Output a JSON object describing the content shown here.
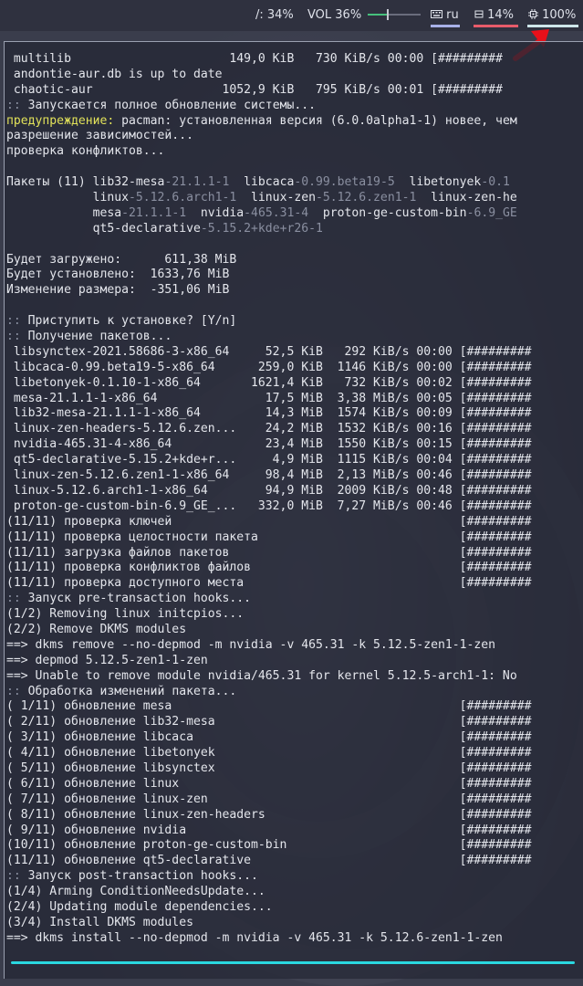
{
  "topbar": {
    "disk_label": "/: 34%",
    "volume_label": "VOL 36%",
    "volume_level": 0.36,
    "keyboard_icon": "keyboard-icon",
    "keyboard_label": "ru",
    "memory_icon": "memory-icon",
    "memory_label": "14%",
    "cpu_icon": "cpu-icon",
    "cpu_label": "100%",
    "underline_colors": {
      "keyboard": "#a8b0e8",
      "memory": "#e85b6a",
      "cpu": "#cde6ea"
    }
  },
  "annotation": {
    "arrow_color": "#e8101a"
  },
  "terminal": {
    "accent_color": "#2ad8e0",
    "lines": [
      [
        {
          "t": " multilib                      149,0 KiB   730 KiB/s 00:00 [#########"
        }
      ],
      [
        {
          "t": " andontie-aur.db is up to date"
        }
      ],
      [
        {
          "t": " chaotic-aur                  1052,9 KiB   795 KiB/s 00:01 [#########"
        }
      ],
      [
        {
          "t": "::",
          "c": "dim"
        },
        {
          "t": " Запускается полное обновление системы..."
        }
      ],
      [
        {
          "t": "предупреждение:",
          "c": "warn"
        },
        {
          "t": " pacman: установленная версия (6.0.0alpha1-1) новее, чем"
        }
      ],
      [
        {
          "t": "разрешение зависимостей..."
        }
      ],
      [
        {
          "t": "проверка конфликтов..."
        }
      ],
      [
        {
          "t": ""
        }
      ],
      [
        {
          "t": "Пакеты (11) lib32-mesa"
        },
        {
          "t": "-21.1.1-1",
          "c": "dim"
        },
        {
          "t": "  libcaca"
        },
        {
          "t": "-0.99.beta19-5",
          "c": "dim"
        },
        {
          "t": "  libetonyek"
        },
        {
          "t": "-0.1",
          "c": "dim"
        }
      ],
      [
        {
          "t": "            linux"
        },
        {
          "t": "-5.12.6.arch1-1",
          "c": "dim"
        },
        {
          "t": "  linux-zen"
        },
        {
          "t": "-5.12.6.zen1-1",
          "c": "dim"
        },
        {
          "t": "  linux-zen-he"
        }
      ],
      [
        {
          "t": "            mesa"
        },
        {
          "t": "-21.1.1-1",
          "c": "dim"
        },
        {
          "t": "  nvidia"
        },
        {
          "t": "-465.31-4",
          "c": "dim"
        },
        {
          "t": "  proton-ge-custom-bin"
        },
        {
          "t": "-6.9_GE",
          "c": "dim"
        }
      ],
      [
        {
          "t": "            qt5-declarative"
        },
        {
          "t": "-5.15.2+kde+r26-1",
          "c": "dim"
        }
      ],
      [
        {
          "t": ""
        }
      ],
      [
        {
          "t": "Будет загружено:      611,38 MiB"
        }
      ],
      [
        {
          "t": "Будет установлено:  1633,76 MiB"
        }
      ],
      [
        {
          "t": "Изменение размера:  -351,06 MiB"
        }
      ],
      [
        {
          "t": ""
        }
      ],
      [
        {
          "t": "::",
          "c": "dim"
        },
        {
          "t": " Приступить к установке? [Y/n]"
        }
      ],
      [
        {
          "t": "::",
          "c": "dim"
        },
        {
          "t": " Получение пакетов..."
        }
      ],
      [
        {
          "t": " libsynctex-2021.58686-3-x86_64     52,5 KiB   292 KiB/s 00:00 [#########"
        }
      ],
      [
        {
          "t": " libcaca-0.99.beta19-5-x86_64      259,0 KiB  1146 KiB/s 00:00 [#########"
        }
      ],
      [
        {
          "t": " libetonyek-0.1.10-1-x86_64       1621,4 KiB   732 KiB/s 00:02 [#########"
        }
      ],
      [
        {
          "t": " mesa-21.1.1-1-x86_64               17,5 MiB  3,38 MiB/s 00:05 [#########"
        }
      ],
      [
        {
          "t": " lib32-mesa-21.1.1-1-x86_64         14,3 MiB  1574 KiB/s 00:09 [#########"
        }
      ],
      [
        {
          "t": " linux-zen-headers-5.12.6.zen...    24,2 MiB  1532 KiB/s 00:16 [#########"
        }
      ],
      [
        {
          "t": " nvidia-465.31-4-x86_64             23,4 MiB  1550 KiB/s 00:15 [#########"
        }
      ],
      [
        {
          "t": " qt5-declarative-5.15.2+kde+r...     4,9 MiB  1115 KiB/s 00:04 [#########"
        }
      ],
      [
        {
          "t": " linux-zen-5.12.6.zen1-1-x86_64     98,4 MiB  2,13 MiB/s 00:46 [#########"
        }
      ],
      [
        {
          "t": " linux-5.12.6.arch1-1-x86_64        94,9 MiB  2009 KiB/s 00:48 [#########"
        }
      ],
      [
        {
          "t": " proton-ge-custom-bin-6.9_GE_...   332,0 MiB  7,27 MiB/s 00:46 [#########"
        }
      ],
      [
        {
          "t": "(11/11) проверка ключей                                        [#########"
        }
      ],
      [
        {
          "t": "(11/11) проверка целостности пакета                            [#########"
        }
      ],
      [
        {
          "t": "(11/11) загрузка файлов пакетов                                [#########"
        }
      ],
      [
        {
          "t": "(11/11) проверка конфликтов файлов                             [#########"
        }
      ],
      [
        {
          "t": "(11/11) проверка доступного места                              [#########"
        }
      ],
      [
        {
          "t": "::",
          "c": "dim"
        },
        {
          "t": " Запуск pre-transaction hooks..."
        }
      ],
      [
        {
          "t": "(1/2) Removing linux initcpios..."
        }
      ],
      [
        {
          "t": "(2/2) Remove DKMS modules"
        }
      ],
      [
        {
          "t": "==> dkms remove --no-depmod -m nvidia -v 465.31 -k 5.12.5-zen1-1-zen"
        }
      ],
      [
        {
          "t": "==> depmod 5.12.5-zen1-1-zen"
        }
      ],
      [
        {
          "t": "==> Unable to remove module nvidia/465.31 for kernel 5.12.5-arch1-1: No"
        }
      ],
      [
        {
          "t": "::",
          "c": "dim"
        },
        {
          "t": " Обработка изменений пакета..."
        }
      ],
      [
        {
          "t": "( 1/11) обновление mesa                                        [#########"
        }
      ],
      [
        {
          "t": "( 2/11) обновление lib32-mesa                                  [#########"
        }
      ],
      [
        {
          "t": "( 3/11) обновление libcaca                                     [#########"
        }
      ],
      [
        {
          "t": "( 4/11) обновление libetonyek                                  [#########"
        }
      ],
      [
        {
          "t": "( 5/11) обновление libsynctex                                  [#########"
        }
      ],
      [
        {
          "t": "( 6/11) обновление linux                                       [#########"
        }
      ],
      [
        {
          "t": "( 7/11) обновление linux-zen                                   [#########"
        }
      ],
      [
        {
          "t": "( 8/11) обновление linux-zen-headers                           [#########"
        }
      ],
      [
        {
          "t": "( 9/11) обновление nvidia                                      [#########"
        }
      ],
      [
        {
          "t": "(10/11) обновление proton-ge-custom-bin                        [#########"
        }
      ],
      [
        {
          "t": "(11/11) обновление qt5-declarative                             [#########"
        }
      ],
      [
        {
          "t": "::",
          "c": "dim"
        },
        {
          "t": " Запуск post-transaction hooks..."
        }
      ],
      [
        {
          "t": "(1/4) Arming ConditionNeedsUpdate..."
        }
      ],
      [
        {
          "t": "(2/4) Updating module dependencies..."
        }
      ],
      [
        {
          "t": "(3/4) Install DKMS modules"
        }
      ],
      [
        {
          "t": "==> dkms install --no-depmod -m nvidia -v 465.31 -k 5.12.6-zen1-1-zen"
        }
      ]
    ]
  }
}
